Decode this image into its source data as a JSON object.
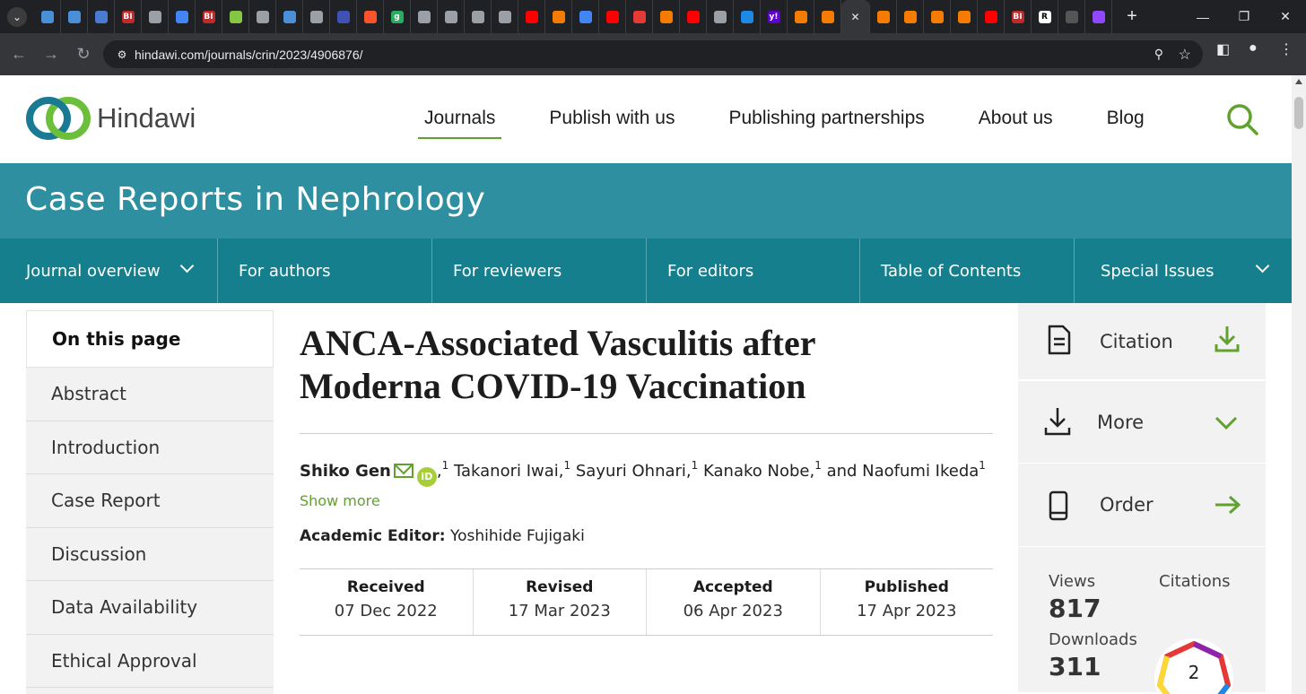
{
  "browser": {
    "url": "hindawi.com/journals/crin/2023/4906876/",
    "tabs": [
      {
        "icon": "shield-icon",
        "color": "#4a90d9"
      },
      {
        "icon": "shield-icon",
        "color": "#4a90d9"
      },
      {
        "icon": "play-arrow-icon",
        "color": "#4a7bd0"
      },
      {
        "icon": "bi-logo-icon",
        "color": "#c62828",
        "text": "BI"
      },
      {
        "icon": "globe-icon",
        "color": "#9aa0a6"
      },
      {
        "icon": "search-icon",
        "color": "#4285f4"
      },
      {
        "icon": "bi-logo-icon",
        "color": "#c62828",
        "text": "BI"
      },
      {
        "icon": "rumble-icon",
        "color": "#85c742"
      },
      {
        "icon": "globe-icon",
        "color": "#9aa0a6"
      },
      {
        "icon": "shield-icon",
        "color": "#4a90d9"
      },
      {
        "icon": "globe-icon",
        "color": "#9aa0a6"
      },
      {
        "icon": "grid-icon",
        "color": "#3f51b5"
      },
      {
        "icon": "brave-icon",
        "color": "#fb542b"
      },
      {
        "icon": "g-icon",
        "color": "#27ae60",
        "text": "g"
      },
      {
        "icon": "globe-icon",
        "color": "#9aa0a6"
      },
      {
        "icon": "slash-icon",
        "color": "#9aa0a6"
      },
      {
        "icon": "globe-icon",
        "color": "#9aa0a6"
      },
      {
        "icon": "globe-icon",
        "color": "#9aa0a6"
      },
      {
        "icon": "youtube-icon",
        "color": "#ff0000"
      },
      {
        "icon": "bookmark-icon",
        "color": "#f57c00"
      },
      {
        "icon": "search-icon",
        "color": "#4285f4"
      },
      {
        "icon": "youtube-icon",
        "color": "#ff0000"
      },
      {
        "icon": "mic-icon",
        "color": "#e53935"
      },
      {
        "icon": "bookmark-icon",
        "color": "#f57c00"
      },
      {
        "icon": "youtube-icon",
        "color": "#ff0000"
      },
      {
        "icon": "slash-icon",
        "color": "#9aa0a6"
      },
      {
        "icon": "c-icon",
        "color": "#1e88e5"
      },
      {
        "icon": "yahoo-icon",
        "color": "#6001d2",
        "text": "y!"
      },
      {
        "icon": "bookmark-icon",
        "color": "#f57c00"
      },
      {
        "icon": "bookmark-icon",
        "color": "#f57c00"
      }
    ],
    "tabs_after": [
      {
        "icon": "bookmark-icon",
        "color": "#f57c00"
      },
      {
        "icon": "bookmark-icon",
        "color": "#f57c00"
      },
      {
        "icon": "bookmark-icon",
        "color": "#f57c00"
      },
      {
        "icon": "bookmark-icon",
        "color": "#f57c00"
      },
      {
        "icon": "youtube-icon",
        "color": "#ff0000"
      },
      {
        "icon": "bi-logo-icon",
        "color": "#c62828",
        "text": "BI"
      },
      {
        "icon": "rg-icon",
        "color": "#fff",
        "text": "R"
      },
      {
        "icon": "globe-icon",
        "color": "#555"
      },
      {
        "icon": "twitch-icon",
        "color": "#9146ff"
      }
    ]
  },
  "site": {
    "logo_text": "Hindawi",
    "nav": [
      "Journals",
      "Publish with us",
      "Publishing partnerships",
      "About us",
      "Blog"
    ],
    "journal_title": "Case Reports in Nephrology",
    "subnav": [
      "Journal overview",
      "For authors",
      "For reviewers",
      "For editors",
      "Table of Contents",
      "Special Issues"
    ]
  },
  "on_this_page": {
    "heading": "On this page",
    "items": [
      "Abstract",
      "Introduction",
      "Case Report",
      "Discussion",
      "Data Availability",
      "Ethical Approval"
    ]
  },
  "article": {
    "title": "ANCA-Associated Vasculitis after Moderna COVID-19 Vaccination",
    "authors": {
      "first": "Shiko Gen",
      "sup": "1",
      "sep": ",",
      "others": [
        {
          "name": "Takanori Iwai,",
          "sup": "1"
        },
        {
          "name": "Sayuri Ohnari,",
          "sup": "1"
        },
        {
          "name": "Kanako Nobe,",
          "sup": "1"
        },
        {
          "name": "and Naofumi Ikeda",
          "sup": "1"
        }
      ]
    },
    "orcid_label": "iD",
    "show_more": "Show more",
    "editor_label": "Academic Editor:",
    "editor_name": "Yoshihide Fujigaki",
    "dates": [
      {
        "label": "Received",
        "value": "07 Dec 2022"
      },
      {
        "label": "Revised",
        "value": "17 Mar 2023"
      },
      {
        "label": "Accepted",
        "value": "06 Apr 2023"
      },
      {
        "label": "Published",
        "value": "17 Apr 2023"
      }
    ]
  },
  "sidebar": {
    "citation": "Citation",
    "more": "More",
    "order": "Order",
    "views_label": "Views",
    "views": "817",
    "downloads_label": "Downloads",
    "downloads": "311",
    "citations_label": "Citations",
    "citations_badge": "2"
  }
}
